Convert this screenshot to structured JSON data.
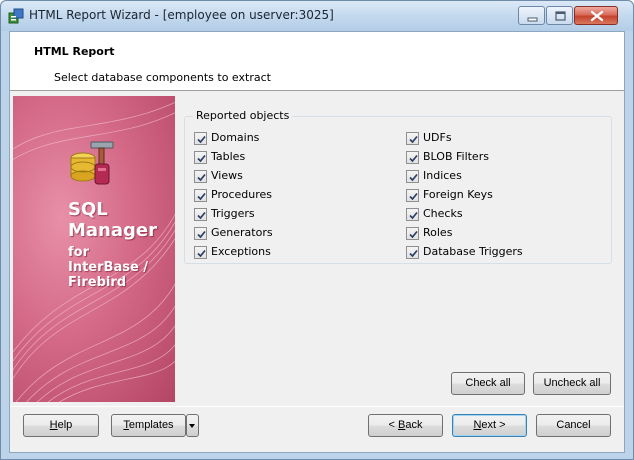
{
  "window": {
    "title": "HTML Report Wizard - [employee on userver:3025]"
  },
  "header": {
    "title": "HTML Report",
    "subtitle": "Select database components to extract"
  },
  "branding": {
    "line1": "SQL",
    "line2": "Manager",
    "line3": "for",
    "line4": "InterBase /",
    "line5": "Firebird"
  },
  "reported_objects": {
    "caption": "Reported objects",
    "left": [
      {
        "label": "Domains",
        "checked": true
      },
      {
        "label": "Tables",
        "checked": true
      },
      {
        "label": "Views",
        "checked": true
      },
      {
        "label": "Procedures",
        "checked": true
      },
      {
        "label": "Triggers",
        "checked": true
      },
      {
        "label": "Generators",
        "checked": true
      },
      {
        "label": "Exceptions",
        "checked": true
      }
    ],
    "right": [
      {
        "label": "UDFs",
        "checked": true
      },
      {
        "label": "BLOB Filters",
        "checked": true
      },
      {
        "label": "Indices",
        "checked": true
      },
      {
        "label": "Foreign Keys",
        "checked": true
      },
      {
        "label": "Checks",
        "checked": true
      },
      {
        "label": "Roles",
        "checked": true
      },
      {
        "label": "Database Triggers",
        "checked": true
      }
    ]
  },
  "actions": {
    "check_all": "Check all",
    "uncheck_all": "Uncheck all"
  },
  "footer": {
    "help": {
      "pre": "",
      "u": "H",
      "post": "elp"
    },
    "templates": {
      "pre": "",
      "u": "T",
      "post": "emplates"
    },
    "back": {
      "pre": "< ",
      "u": "B",
      "post": "ack"
    },
    "next": {
      "pre": "",
      "u": "N",
      "post": "ext >"
    },
    "cancel": "Cancel"
  },
  "colors": {
    "titlebar": "#c4d9ee",
    "brand_panel": "#d46a88",
    "close_button": "#c5422c",
    "default_button_border": "#3c7fb1"
  },
  "icons": {
    "app": "report-wizard-icon",
    "brand": "database-tools-icon",
    "minimize": "minimize-icon",
    "maximize": "maximize-icon",
    "close": "close-icon",
    "dropdown": "dropdown-arrow-icon",
    "check": "checkmark-icon"
  }
}
